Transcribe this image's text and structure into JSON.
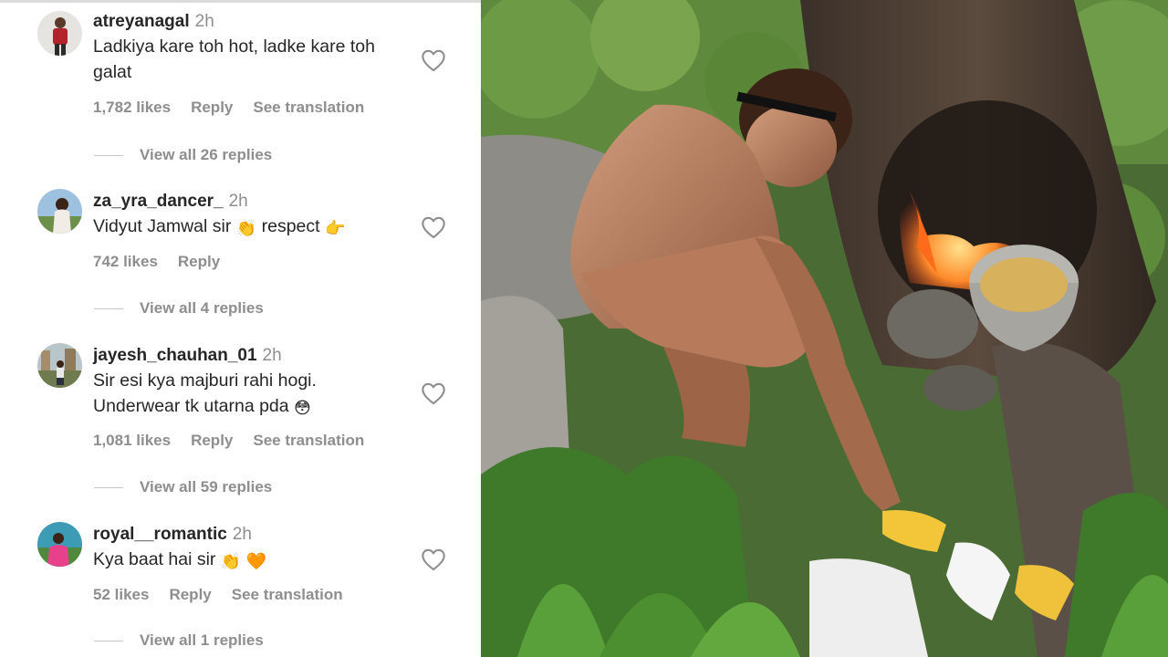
{
  "comments": [
    {
      "username": "atreyanagal",
      "time": "2h",
      "text": "Ladkiya kare toh hot, ladke kare toh galat",
      "likes": "1,782 likes",
      "reply": "Reply",
      "translate": "See translation",
      "view_replies": "View all 26 replies"
    },
    {
      "username": "za_yra_dancer_",
      "time": "2h",
      "text_before": "Vidyut Jamwal sir",
      "emoji1": "👏",
      "text_mid": "respect",
      "emoji2": "👉",
      "likes": "742 likes",
      "reply": "Reply",
      "view_replies": "View all 4 replies"
    },
    {
      "username": "jayesh_chauhan_01",
      "time": "2h",
      "text": "Sir esi kya majburi rahi hogi. Underwear tk utarna pda",
      "emoji": "😳",
      "likes": "1,081 likes",
      "reply": "Reply",
      "translate": "See translation",
      "view_replies": "View all 59 replies"
    },
    {
      "username": "royal__romantic",
      "time": "2h",
      "text": "Kya baat hai sir",
      "emoji1": "👏",
      "emoji2": "🧡",
      "likes": "52 likes",
      "reply": "Reply",
      "translate": "See translation",
      "view_replies": "View all 1 replies"
    }
  ],
  "icons": {
    "like": "heart-outline-icon"
  },
  "colors": {
    "text": "#262626",
    "secondary": "#8e8e8e",
    "divider": "#dbdbdb"
  }
}
